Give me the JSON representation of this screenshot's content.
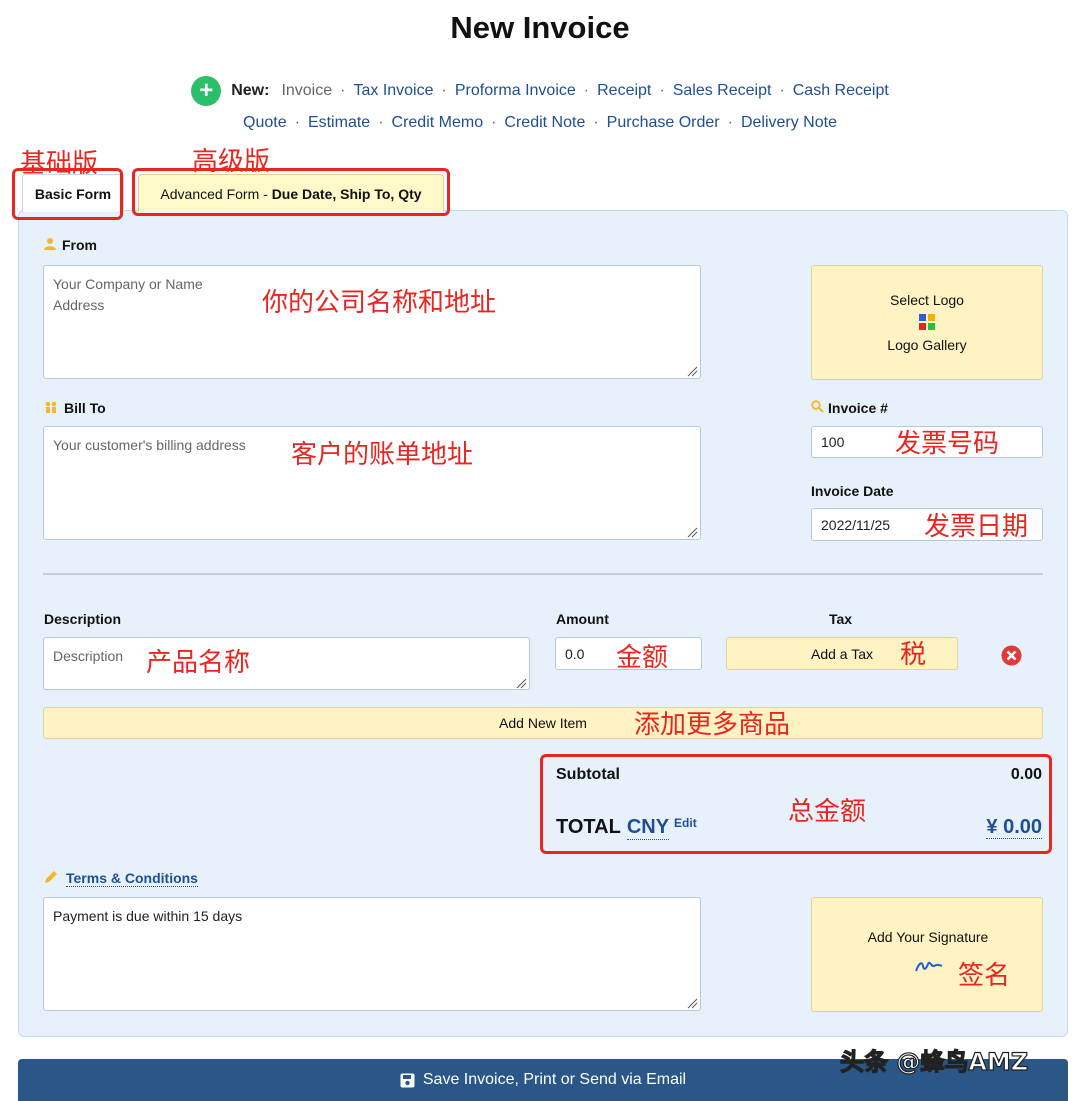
{
  "page_title": "New Invoice",
  "new_menu": {
    "label": "New:",
    "row1": [
      "Invoice",
      "Tax Invoice",
      "Proforma Invoice",
      "Receipt",
      "Sales Receipt",
      "Cash Receipt"
    ],
    "row2": [
      "Quote",
      "Estimate",
      "Credit Memo",
      "Credit Note",
      "Purchase Order",
      "Delivery Note"
    ]
  },
  "annotations": {
    "basic": "基础版",
    "advanced": "高级版",
    "company": "你的公司名称和地址",
    "customer": "客户的账单地址",
    "invoice_no": "发票号码",
    "invoice_date": "发票日期",
    "product": "产品名称",
    "amount": "金额",
    "tax": "税",
    "add_more": "添加更多商品",
    "total": "总金额",
    "signature": "签名"
  },
  "tabs": {
    "basic": "Basic Form",
    "advanced_prefix": "Advanced Form - ",
    "advanced_bold": "Due Date, Ship To, Qty"
  },
  "from": {
    "label": "From",
    "placeholder": "Your Company or Name\nAddress"
  },
  "logo": {
    "select": "Select Logo",
    "gallery": "Logo Gallery"
  },
  "bill_to": {
    "label": "Bill To",
    "placeholder": "Your customer's billing address"
  },
  "invoice_number": {
    "label": "Invoice #",
    "value": "100"
  },
  "invoice_date": {
    "label": "Invoice Date",
    "value": "2022/11/25"
  },
  "items": {
    "description_header": "Description",
    "amount_header": "Amount",
    "tax_header": "Tax",
    "description_placeholder": "Description",
    "amount_value": "0.0",
    "add_tax": "Add a Tax",
    "add_item": "Add New Item"
  },
  "totals": {
    "subtotal_label": "Subtotal",
    "subtotal_value": "0.00",
    "total_label": "TOTAL",
    "currency": "CNY",
    "edit": "Edit",
    "total_value": "¥ 0.00"
  },
  "terms": {
    "label": "Terms & Conditions",
    "value": "Payment is due within 15 days"
  },
  "signature": {
    "label": "Add Your Signature"
  },
  "save_button": "Save Invoice, Print or Send via Email",
  "watermark": "头条 @蜂鸟AMZ"
}
